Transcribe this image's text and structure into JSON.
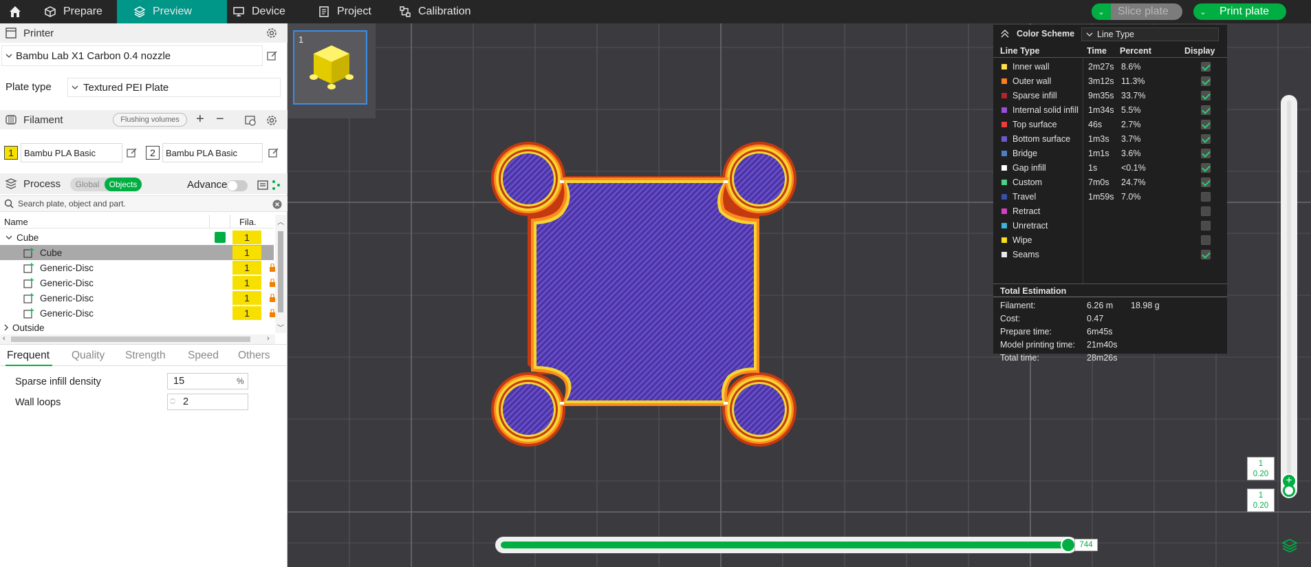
{
  "topbar": {
    "tabs": [
      {
        "label": "Prepare",
        "icon": "cube-outline-icon"
      },
      {
        "label": "Preview",
        "icon": "layers-icon",
        "active": true
      },
      {
        "label": "Device",
        "icon": "monitor-icon"
      },
      {
        "label": "Project",
        "icon": "document-icon"
      },
      {
        "label": "Calibration",
        "icon": "calibration-icon"
      }
    ],
    "slice_label": "Slice plate",
    "print_label": "Print plate",
    "accent": "#00ae42",
    "active_tab_color": "#009688"
  },
  "printer": {
    "title": "Printer",
    "preset": "Bambu Lab X1 Carbon 0.4 nozzle",
    "plate_type_label": "Plate type",
    "plate_type": "Textured PEI Plate"
  },
  "filament": {
    "title": "Filament",
    "flushing_label": "Flushing volumes",
    "slots": [
      {
        "num": "1",
        "name": "Bambu PLA Basic",
        "color": "#f7e000"
      },
      {
        "num": "2",
        "name": "Bambu PLA Basic",
        "color": "#ffffff"
      }
    ]
  },
  "process": {
    "title": "Process",
    "global_label": "Global",
    "objects_label": "Objects",
    "advance_label": "Advance",
    "search_placeholder": "Search plate, object and part."
  },
  "tree": {
    "col_name": "Name",
    "col_fila": "Fila.",
    "rows": [
      {
        "name": "Cube",
        "fila": "1"
      },
      {
        "name": "Cube",
        "fila": "1"
      },
      {
        "name": "Generic-Disc",
        "fila": "1"
      },
      {
        "name": "Generic-Disc",
        "fila": "1"
      },
      {
        "name": "Generic-Disc",
        "fila": "1"
      },
      {
        "name": "Generic-Disc",
        "fila": "1"
      },
      {
        "name": "Outside"
      }
    ]
  },
  "params": {
    "tabs": [
      "Frequent",
      "Quality",
      "Strength",
      "Speed",
      "Others"
    ],
    "sparse_label": "Sparse infill density",
    "sparse_value": "15",
    "sparse_unit": "%",
    "wall_label": "Wall loops",
    "wall_value": "2"
  },
  "plate": {
    "number": "1"
  },
  "legend": {
    "title": "Color Scheme",
    "scheme": "Line Type",
    "headers": [
      "Line Type",
      "Time",
      "Percent",
      "Display"
    ],
    "rows": [
      {
        "name": "Inner wall",
        "time": "2m27s",
        "pct": "8.6%",
        "color": "#ffe14d",
        "on": true
      },
      {
        "name": "Outer wall",
        "time": "3m12s",
        "pct": "11.3%",
        "color": "#ff7c1f",
        "on": true
      },
      {
        "name": "Sparse infill",
        "time": "9m35s",
        "pct": "33.7%",
        "color": "#b2252e",
        "on": true
      },
      {
        "name": "Internal solid infill",
        "time": "1m34s",
        "pct": "5.5%",
        "color": "#9c4fd6",
        "on": true
      },
      {
        "name": "Top surface",
        "time": "46s",
        "pct": "2.7%",
        "color": "#f03c3c",
        "on": true
      },
      {
        "name": "Bottom surface",
        "time": "1m3s",
        "pct": "3.7%",
        "color": "#6a5acd",
        "on": true
      },
      {
        "name": "Bridge",
        "time": "1m1s",
        "pct": "3.6%",
        "color": "#4d7ec8",
        "on": true
      },
      {
        "name": "Gap infill",
        "time": "1s",
        "pct": "<0.1%",
        "color": "#ffffff",
        "on": true
      },
      {
        "name": "Custom",
        "time": "7m0s",
        "pct": "24.7%",
        "color": "#4fd08a",
        "on": true
      },
      {
        "name": "Travel",
        "time": "1m59s",
        "pct": "7.0%",
        "color": "#3850a8",
        "on": false
      },
      {
        "name": "Retract",
        "time": "",
        "pct": "",
        "color": "#d63fc8",
        "on": false
      },
      {
        "name": "Unretract",
        "time": "",
        "pct": "",
        "color": "#3fb0d6",
        "on": false
      },
      {
        "name": "Wipe",
        "time": "",
        "pct": "",
        "color": "#f5e21c",
        "on": false
      },
      {
        "name": "Seams",
        "time": "",
        "pct": "",
        "color": "#e8e8e8",
        "on": true
      }
    ],
    "total_title": "Total Estimation",
    "filament_label": "Filament:",
    "filament_len": "6.26 m",
    "filament_weight": "18.98 g",
    "cost_label": "Cost:",
    "cost": "0.47",
    "prepare_label": "Prepare time:",
    "prepare": "6m45s",
    "model_label": "Model printing time:",
    "model": "21m40s",
    "total_label": "Total time:",
    "total": "28m26s"
  },
  "layer_slider": {
    "top_layer": "1",
    "top_height": "0.20",
    "bottom_layer": "1",
    "bottom_height": "0.20"
  },
  "move_slider": {
    "value": "744",
    "progress": 1.0
  }
}
